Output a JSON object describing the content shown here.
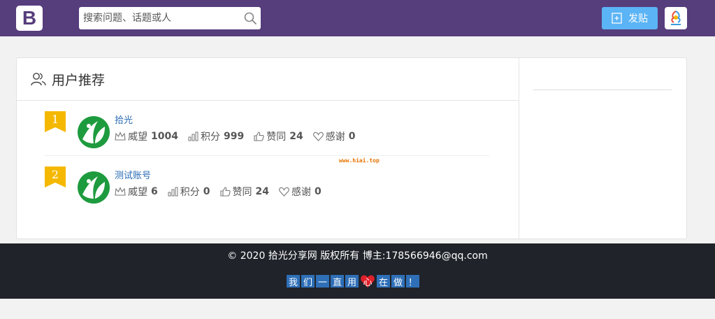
{
  "header": {
    "logo_letter": "B",
    "search_placeholder": "搜索问题、话题或人",
    "post_button": "发贴"
  },
  "section": {
    "title": "用户推荐"
  },
  "stat_labels": {
    "prestige": "威望",
    "points": "积分",
    "likes": "赞同",
    "thanks": "感谢"
  },
  "users": [
    {
      "rank": "1",
      "name": "拾光",
      "prestige": "1004",
      "points": "999",
      "likes": "24",
      "thanks": "0"
    },
    {
      "rank": "2",
      "name": "测试账号",
      "prestige": "6",
      "points": "0",
      "likes": "24",
      "thanks": "0"
    }
  ],
  "watermark": "www.hiai.top",
  "footer": {
    "copyright": "© 2020 拾光分享网 版权所有 博主:178566946@qq.com",
    "slogan_before": [
      "我",
      "们",
      "一",
      "直",
      "用"
    ],
    "slogan_heart": "心",
    "slogan_after": [
      "在",
      "做",
      "！"
    ]
  },
  "colors": {
    "header_bg": "#563d7c",
    "post_button_bg": "#5bb4f5",
    "rank_badge": "#f5b800",
    "footer_bg": "#20232a",
    "link": "#2a6bb5"
  }
}
